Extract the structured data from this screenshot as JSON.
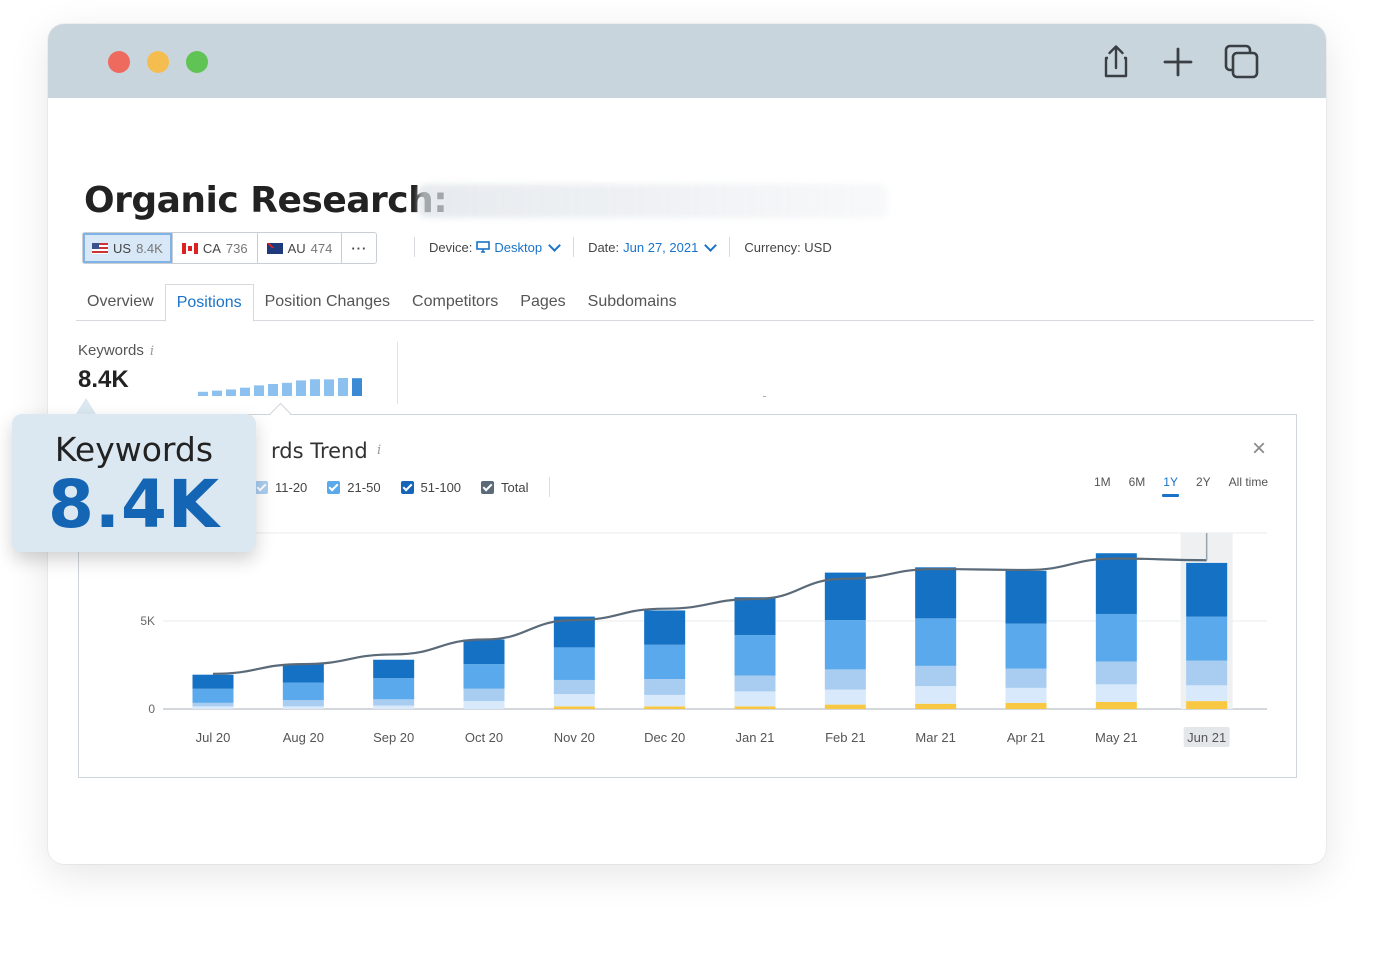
{
  "page": {
    "title": "Organic Research:",
    "databases": [
      {
        "code": "US",
        "count": "8.4K",
        "flag": "us-flag-icon"
      },
      {
        "code": "CA",
        "count": "736",
        "flag": "ca-flag-icon"
      },
      {
        "code": "AU",
        "count": "474",
        "flag": "au-flag-icon"
      }
    ],
    "more_label": "···",
    "device_label": "Device:",
    "device_value": "Desktop",
    "date_label": "Date:",
    "date_value": "Jun 27, 2021",
    "currency_label": "Currency: USD",
    "tabs": [
      "Overview",
      "Positions",
      "Position Changes",
      "Competitors",
      "Pages",
      "Subdomains"
    ],
    "active_tab": "Positions"
  },
  "summary": {
    "label": "Keywords",
    "info": "i",
    "value": "8.4K"
  },
  "panel": {
    "title": "rds Trend",
    "info": "i",
    "close": "×",
    "legend": [
      {
        "label": "11-20",
        "color": "#a9cdf0"
      },
      {
        "label": "21-50",
        "color": "#5aa9ec"
      },
      {
        "label": "51-100",
        "color": "#1565b9"
      },
      {
        "label": "Total",
        "color": "#5a6a78"
      }
    ],
    "ranges": [
      "1M",
      "6M",
      "1Y",
      "2Y",
      "All time"
    ],
    "active_range": "1Y"
  },
  "callout": {
    "label": "Keywords",
    "value": "8.4K"
  },
  "colors": {
    "top3": "#f9c843",
    "pos4_10": "#d7e9fb",
    "pos11_20": "#a9cdf0",
    "pos21_50": "#5aa9ec",
    "pos51_100": "#1571c4",
    "total": "#5a6a78",
    "accent": "#1a73c8"
  },
  "chart_data": {
    "type": "bar",
    "categories": [
      "Jul 20",
      "Aug 20",
      "Sep 20",
      "Oct 20",
      "Nov 20",
      "Dec 20",
      "Jan 21",
      "Feb 21",
      "Mar 21",
      "Apr 21",
      "May 21",
      "Jun 21"
    ],
    "series": [
      {
        "values": [
          0,
          0,
          0,
          0,
          150,
          150,
          150,
          250,
          300,
          350,
          400,
          450
        ]
      },
      {
        "values": [
          150,
          150,
          200,
          450,
          700,
          650,
          850,
          850,
          1000,
          850,
          1000,
          900
        ]
      },
      {
        "values": [
          200,
          350,
          350,
          700,
          800,
          900,
          900,
          1150,
          1150,
          1100,
          1300,
          1400
        ]
      },
      {
        "values": [
          800,
          1000,
          1200,
          1400,
          1850,
          1950,
          2300,
          2800,
          2700,
          2550,
          2700,
          2500
        ]
      },
      {
        "values": [
          800,
          1050,
          1050,
          1400,
          1750,
          1950,
          2150,
          2700,
          2900,
          3000,
          3450,
          3050
        ]
      },
      {
        "name": "Total",
        "values": [
          2000,
          2550,
          3100,
          3950,
          5050,
          5700,
          6250,
          7400,
          7950,
          7900,
          8550,
          8450
        ]
      }
    ],
    "yticks": [
      "0",
      "5K"
    ],
    "ylim": [
      0,
      10000
    ],
    "highlight": "Jun 21",
    "grid": true
  }
}
